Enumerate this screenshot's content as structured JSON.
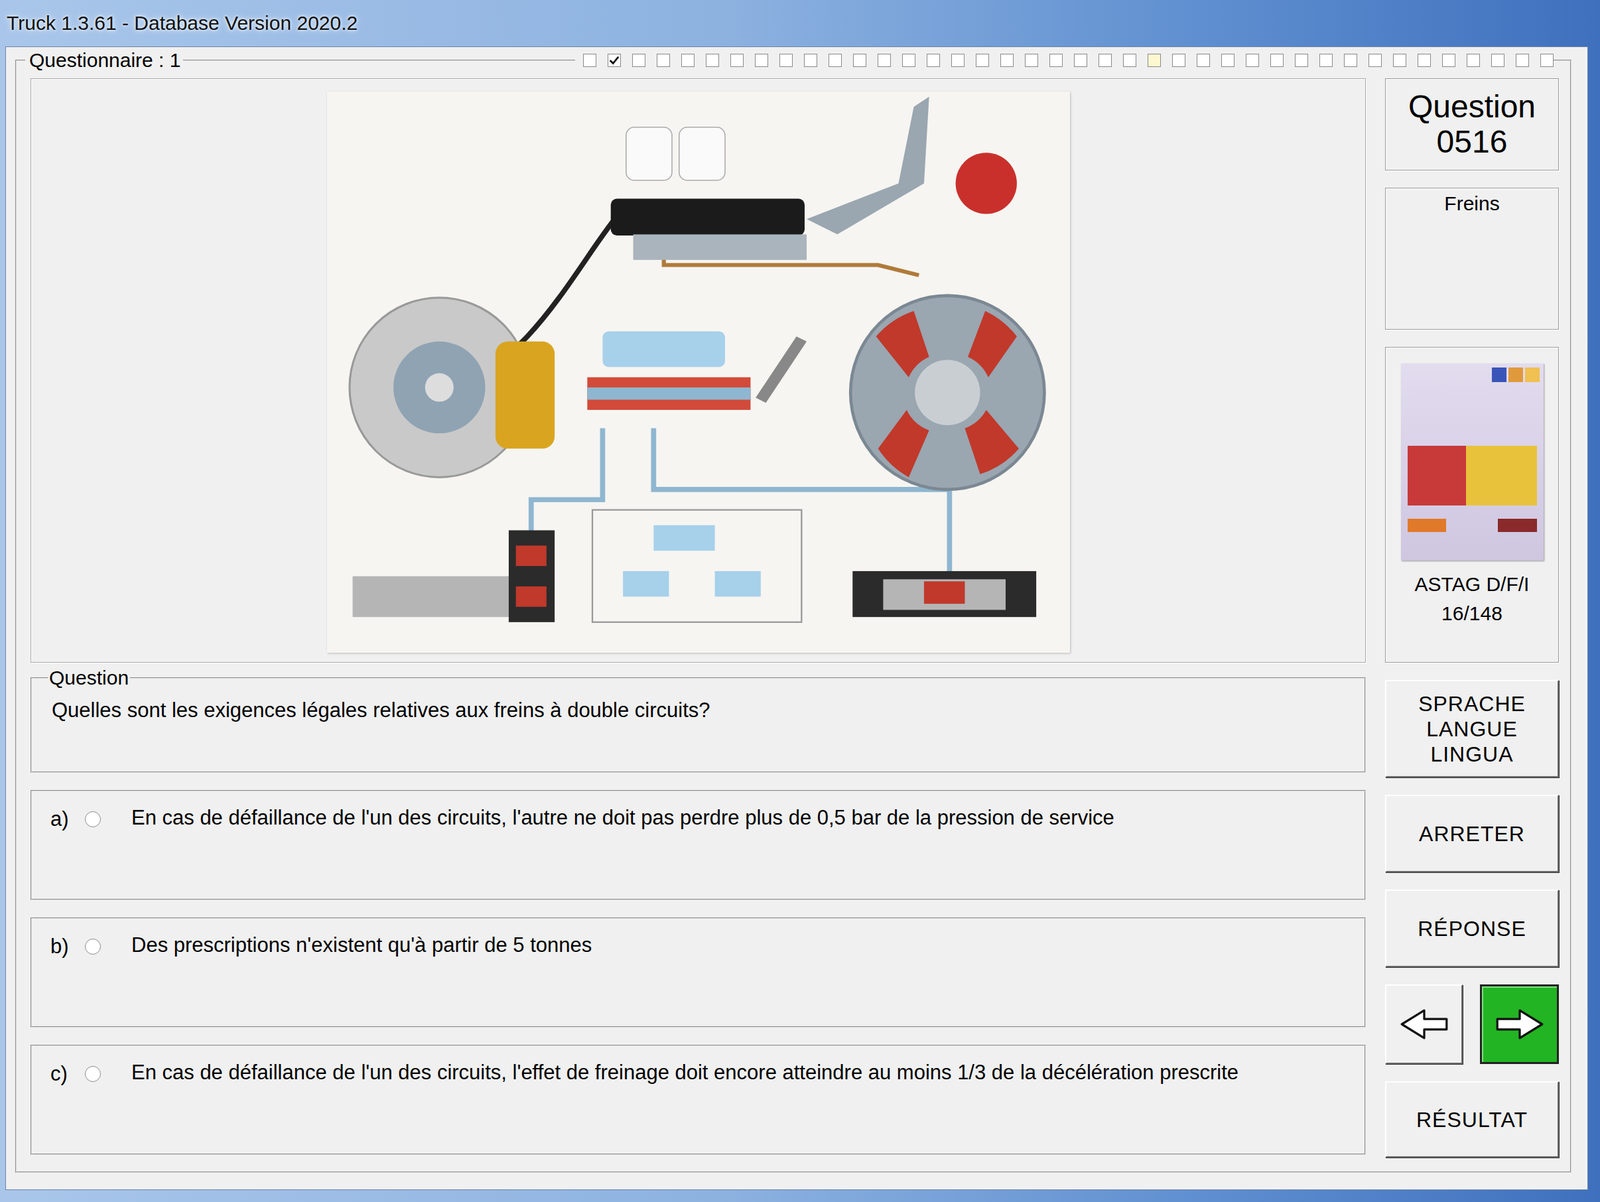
{
  "window": {
    "title": "Truck 1.3.61 - Database Version 2020.2"
  },
  "questionnaire": {
    "label": "Questionnaire : 1",
    "progress": [
      {
        "checked": false,
        "current": false
      },
      {
        "checked": true,
        "current": false
      },
      {
        "checked": false,
        "current": false
      },
      {
        "checked": false,
        "current": false
      },
      {
        "checked": false,
        "current": false
      },
      {
        "checked": false,
        "current": false
      },
      {
        "checked": false,
        "current": false
      },
      {
        "checked": false,
        "current": false
      },
      {
        "checked": false,
        "current": false
      },
      {
        "checked": false,
        "current": false
      },
      {
        "checked": false,
        "current": false
      },
      {
        "checked": false,
        "current": false
      },
      {
        "checked": false,
        "current": false
      },
      {
        "checked": false,
        "current": false
      },
      {
        "checked": false,
        "current": false
      },
      {
        "checked": false,
        "current": false
      },
      {
        "checked": false,
        "current": false
      },
      {
        "checked": false,
        "current": false
      },
      {
        "checked": false,
        "current": false
      },
      {
        "checked": false,
        "current": false
      },
      {
        "checked": false,
        "current": false
      },
      {
        "checked": false,
        "current": false
      },
      {
        "checked": false,
        "current": false
      },
      {
        "checked": false,
        "current": true
      },
      {
        "checked": false,
        "current": false
      },
      {
        "checked": false,
        "current": false
      },
      {
        "checked": false,
        "current": false
      },
      {
        "checked": false,
        "current": false
      },
      {
        "checked": false,
        "current": false
      },
      {
        "checked": false,
        "current": false
      },
      {
        "checked": false,
        "current": false
      },
      {
        "checked": false,
        "current": false
      },
      {
        "checked": false,
        "current": false
      },
      {
        "checked": false,
        "current": false
      },
      {
        "checked": false,
        "current": false
      },
      {
        "checked": false,
        "current": false
      },
      {
        "checked": false,
        "current": false
      },
      {
        "checked": false,
        "current": false
      },
      {
        "checked": false,
        "current": false
      },
      {
        "checked": false,
        "current": false
      }
    ]
  },
  "question": {
    "header_label": "Question",
    "number": "0516",
    "category": "Freins",
    "group_label": "Question",
    "text": "Quelles sont les exigences légales relatives aux freins à double circuits?"
  },
  "source": {
    "title": "ASTAG D/F/I",
    "page": "16/148"
  },
  "answers": [
    {
      "letter": "a)",
      "text": "En cas de défaillance de l'un des circuits, l'autre ne doit pas perdre plus de 0,5 bar de la pression de service",
      "selected": false
    },
    {
      "letter": "b)",
      "text": "Des prescriptions n'existent qu'à partir de 5 tonnes",
      "selected": false
    },
    {
      "letter": "c)",
      "text": "En cas de défaillance de l'un des circuits, l'effet de freinage doit encore atteindre au moins 1/3 de la décélération prescrite",
      "selected": false
    }
  ],
  "buttons": [
    {
      "kind": "text",
      "lines": [
        "SPRACHE",
        "LANGUE",
        "LINGUA"
      ]
    },
    {
      "kind": "text",
      "lines": [
        "ARRETER"
      ]
    },
    {
      "kind": "text",
      "lines": [
        "RÉPONSE"
      ]
    },
    {
      "kind": "nav",
      "back": {
        "highlighted": false
      },
      "next": {
        "highlighted": true
      }
    },
    {
      "kind": "text",
      "lines": [
        "RÉSULTAT"
      ]
    }
  ]
}
